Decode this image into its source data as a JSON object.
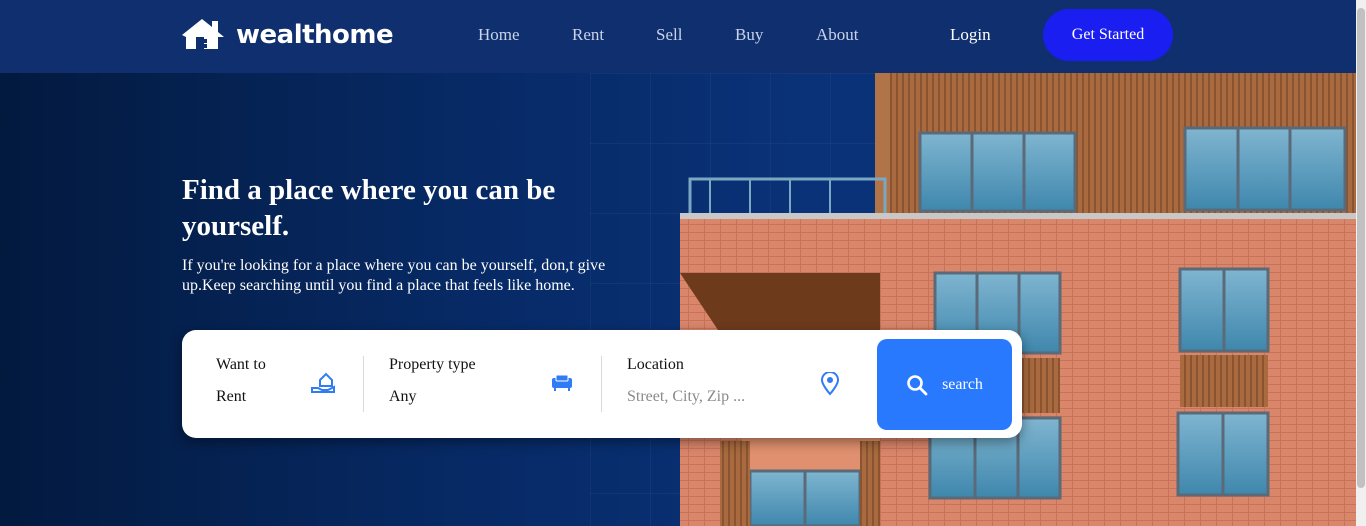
{
  "brand": {
    "name": "wealthome",
    "logo_icon": "house-icon"
  },
  "nav": {
    "items": [
      "Home",
      "Rent",
      "Sell",
      "Buy",
      "About"
    ],
    "login": "Login",
    "cta": "Get Started"
  },
  "hero": {
    "headline": "Find a place where you can be yourself.",
    "subtext": "If you're looking for a place where you can be yourself, don,t give up.Keep searching until you find a place that feels like home."
  },
  "search": {
    "want_to": {
      "label": "Want to",
      "value": "Rent",
      "icon": "hand-house-icon"
    },
    "property_type": {
      "label": "Property type",
      "value": "Any",
      "icon": "sofa-icon"
    },
    "location": {
      "label": "Location",
      "placeholder": "Street, City, Zip ...",
      "icon": "map-pin-icon"
    },
    "button": "search"
  },
  "colors": {
    "header_bg": "#0f2f6e",
    "cta_bg": "#1a1ef0",
    "search_button": "#2979ff",
    "icon_accent": "#2f7cf6"
  }
}
